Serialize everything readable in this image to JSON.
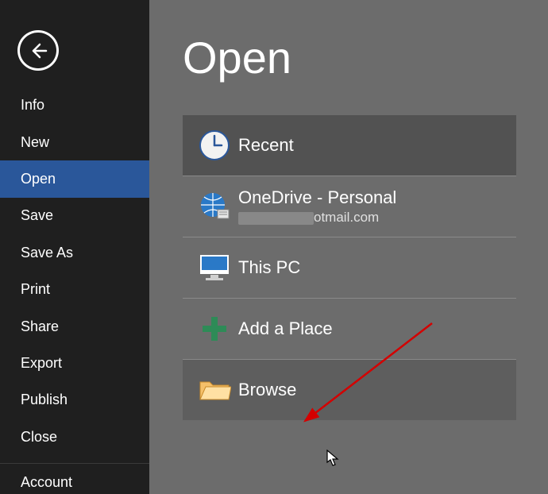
{
  "sidebar": {
    "items": [
      {
        "label": "Info"
      },
      {
        "label": "New"
      },
      {
        "label": "Open"
      },
      {
        "label": "Save"
      },
      {
        "label": "Save As"
      },
      {
        "label": "Print"
      },
      {
        "label": "Share"
      },
      {
        "label": "Export"
      },
      {
        "label": "Publish"
      },
      {
        "label": "Close"
      }
    ],
    "selected_index": 2,
    "account_label": "Account"
  },
  "page": {
    "title": "Open"
  },
  "locations": {
    "recent": {
      "label": "Recent"
    },
    "onedrive": {
      "label": "OneDrive - Personal",
      "subtext_suffix": "otmail.com"
    },
    "thispc": {
      "label": "This PC"
    },
    "addplace": {
      "label": "Add a Place"
    },
    "browse": {
      "label": "Browse"
    }
  }
}
